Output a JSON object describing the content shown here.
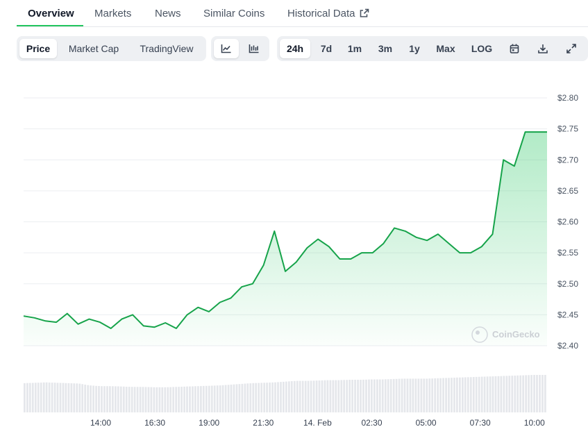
{
  "nav": {
    "tabs": [
      {
        "label": "Overview",
        "active": true
      },
      {
        "label": "Markets"
      },
      {
        "label": "News"
      },
      {
        "label": "Similar Coins"
      },
      {
        "label": "Historical Data"
      }
    ]
  },
  "toolbar": {
    "metric_options": [
      "Price",
      "Market Cap",
      "TradingView"
    ],
    "metric_selected": "Price",
    "chart_style_icons": [
      "line-chart-icon",
      "candlestick-chart-icon"
    ],
    "chart_style_selected": "line-chart-icon",
    "ranges": [
      "24h",
      "7d",
      "1m",
      "3m",
      "1y",
      "Max",
      "LOG"
    ],
    "range_selected": "24h",
    "action_icons": [
      "calendar-icon",
      "download-icon",
      "expand-icon"
    ]
  },
  "colors": {
    "line": "#16a34a",
    "fill_top": "#22c55e",
    "accent_underline": "#22c55e",
    "volume_bars": "#e5e7eb"
  },
  "watermark": "CoinGecko",
  "chart_data": {
    "type": "area",
    "x_ticks": [
      "14:00",
      "16:30",
      "19:00",
      "21:30",
      "14. Feb",
      "02:30",
      "05:00",
      "07:30",
      "10:00"
    ],
    "y_ticks": [
      "$2.40",
      "$2.45",
      "$2.50",
      "$2.55",
      "$2.60",
      "$2.65",
      "$2.70",
      "$2.75",
      "$2.80"
    ],
    "ylim": [
      2.4,
      2.8
    ],
    "grid": true,
    "x_hours": [
      0,
      0.5,
      1,
      1.5,
      2,
      2.5,
      3,
      3.5,
      4,
      4.5,
      5,
      5.5,
      6,
      6.5,
      7,
      7.5,
      8,
      8.5,
      9,
      9.5,
      10,
      10.5,
      11,
      11.5,
      12,
      12.5,
      13,
      13.5,
      14,
      14.5,
      15,
      15.5,
      16,
      16.5,
      17,
      17.5,
      18,
      18.5,
      19,
      19.5,
      20,
      20.5,
      21,
      21.5,
      22,
      22.5,
      23,
      23.5,
      24
    ],
    "series": [
      {
        "values": [
          2.448,
          2.445,
          2.44,
          2.438,
          2.452,
          2.435,
          2.443,
          2.438,
          2.428,
          2.443,
          2.45,
          2.432,
          2.43,
          2.437,
          2.428,
          2.45,
          2.462,
          2.455,
          2.47,
          2.477,
          2.495,
          2.5,
          2.53,
          2.585,
          2.52,
          2.535,
          2.558,
          2.572,
          2.56,
          2.54,
          2.54,
          2.55,
          2.55,
          2.565,
          2.59,
          2.585,
          2.575,
          2.57,
          2.58,
          2.565,
          2.55,
          2.55,
          2.56,
          2.58,
          2.7,
          2.69,
          2.745,
          2.745,
          2.745
        ]
      }
    ],
    "volume_relative": [
      0.78,
      0.79,
      0.8,
      0.79,
      0.78,
      0.77,
      0.72,
      0.7,
      0.7,
      0.69,
      0.68,
      0.68,
      0.67,
      0.67,
      0.68,
      0.69,
      0.7,
      0.71,
      0.72,
      0.74,
      0.76,
      0.78,
      0.79,
      0.8,
      0.82,
      0.84,
      0.84,
      0.85,
      0.86,
      0.86,
      0.87,
      0.87,
      0.88,
      0.88,
      0.89,
      0.9,
      0.9,
      0.9,
      0.91,
      0.92,
      0.93,
      0.94,
      0.95,
      0.96,
      0.97,
      0.98,
      0.99,
      1.0,
      1.0
    ]
  }
}
